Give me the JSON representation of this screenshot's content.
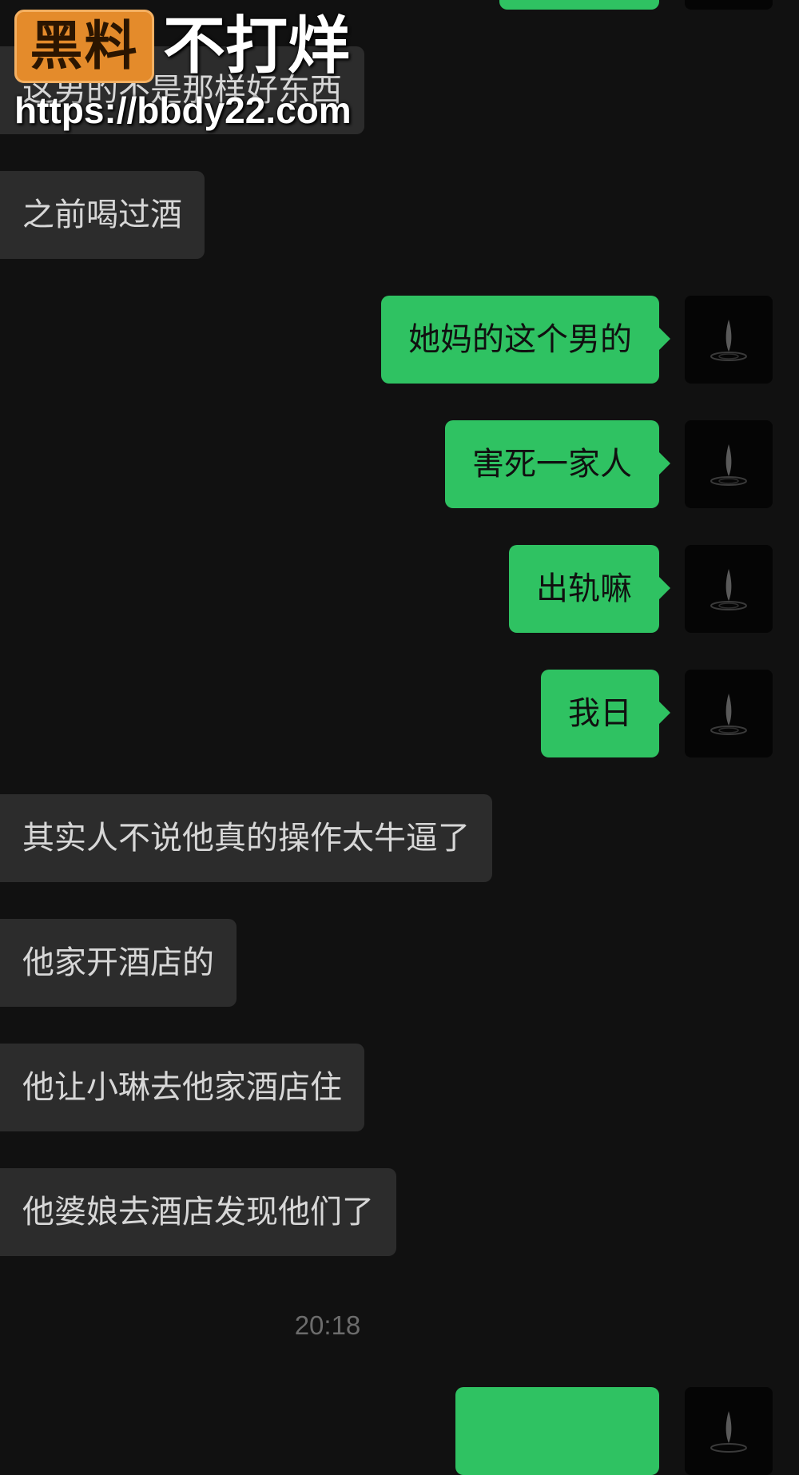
{
  "colors": {
    "background": "#111111",
    "incoming_bubble": "#2c2c2c",
    "outgoing_bubble": "#2fc262",
    "watermark_logo": "#e48b2b"
  },
  "watermark": {
    "logo_text": "黑料",
    "slogan": "不打烊",
    "url": "https://bbdy22.com"
  },
  "messages": [
    {
      "side": "outgoing",
      "text": "",
      "partial": true
    },
    {
      "side": "incoming",
      "text": "这男的不是那样好东西"
    },
    {
      "side": "incoming",
      "text": "之前喝过酒"
    },
    {
      "side": "outgoing",
      "text": "她妈的这个男的"
    },
    {
      "side": "outgoing",
      "text": "害死一家人"
    },
    {
      "side": "outgoing",
      "text": "出轨嘛"
    },
    {
      "side": "outgoing",
      "text": "我日"
    },
    {
      "side": "incoming",
      "text": "其实人不说他真的操作太牛逼了"
    },
    {
      "side": "incoming",
      "text": "他家开酒店的"
    },
    {
      "side": "incoming",
      "text": "他让小琳去他家酒店住"
    },
    {
      "side": "incoming",
      "text": "他婆娘去酒店发现他们了"
    },
    {
      "side": "outgoing",
      "text": "",
      "partial": true
    }
  ],
  "timestamp": "20:18",
  "avatar_icon": "water-drop-avatar-icon"
}
